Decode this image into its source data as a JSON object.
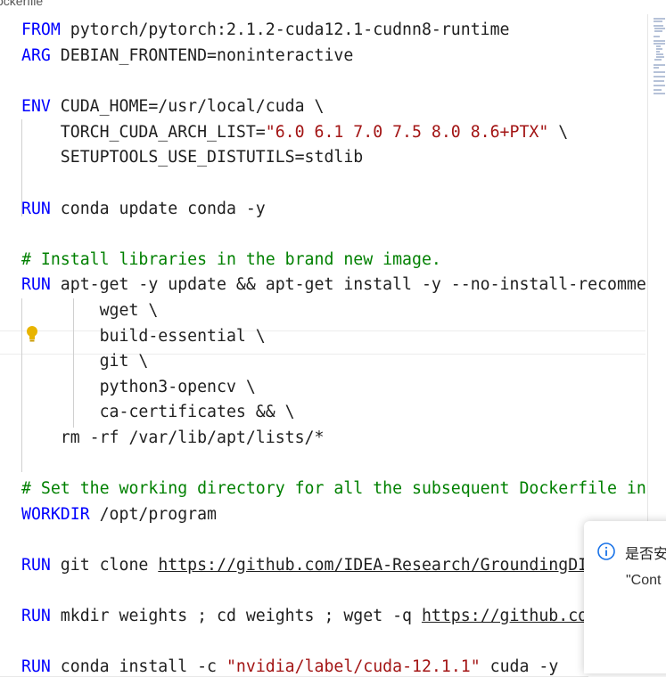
{
  "tab": {
    "title": "ockerfile"
  },
  "editor": {
    "lines": [
      [
        {
          "t": "FROM",
          "c": "kw"
        },
        {
          "t": " pytorch/pytorch:2.1.2-cuda12.1-cudnn8-runtime"
        }
      ],
      [
        {
          "t": "ARG",
          "c": "kw"
        },
        {
          "t": " DEBIAN_FRONTEND=noninteractive"
        }
      ],
      [],
      [
        {
          "t": "ENV",
          "c": "kw"
        },
        {
          "t": " CUDA_HOME=/usr/local/cuda \\"
        }
      ],
      [
        {
          "t": "    TORCH_CUDA_ARCH_LIST="
        },
        {
          "t": "\"6.0 6.1 7.0 7.5 8.0 8.6+PTX\"",
          "c": "str"
        },
        {
          "t": " \\"
        }
      ],
      [
        {
          "t": "    SETUPTOOLS_USE_DISTUTILS=stdlib"
        }
      ],
      [],
      [
        {
          "t": "RUN",
          "c": "kw"
        },
        {
          "t": " conda update conda -y"
        }
      ],
      [],
      [
        {
          "t": "# Install libraries in the brand new image.",
          "c": "cmt"
        }
      ],
      [
        {
          "t": "RUN",
          "c": "kw"
        },
        {
          "t": " apt-get -y update && apt-get install -y --no-install-recommends \\"
        }
      ],
      [
        {
          "t": "        wget \\"
        }
      ],
      [
        {
          "t": "        build-essential \\"
        }
      ],
      [
        {
          "t": "        git \\"
        }
      ],
      [
        {
          "t": "        python3-opencv \\"
        }
      ],
      [
        {
          "t": "        ca-certificates && \\"
        }
      ],
      [
        {
          "t": "    rm -rf /var/lib/apt/lists/*"
        }
      ],
      [],
      [
        {
          "t": "# Set the working directory for all the subsequent Dockerfile instructions.",
          "c": "cmt"
        }
      ],
      [
        {
          "t": "WORKDIR",
          "c": "kw"
        },
        {
          "t": " /opt/program"
        }
      ],
      [],
      [
        {
          "t": "RUN",
          "c": "kw"
        },
        {
          "t": " git clone "
        },
        {
          "t": "https://github.com/IDEA-Research/GroundingDINO.git",
          "c": "url"
        }
      ],
      [],
      [
        {
          "t": "RUN",
          "c": "kw"
        },
        {
          "t": " mkdir weights ; cd weights ; wget -q "
        },
        {
          "t": "https://github.com/IDEA-Research",
          "c": "url"
        }
      ],
      [],
      [
        {
          "t": "RUN",
          "c": "kw"
        },
        {
          "t": " conda install -c "
        },
        {
          "t": "\"nvidia/label/cuda-12.1.1\"",
          "c": "str"
        },
        {
          "t": " cuda -y"
        }
      ]
    ]
  },
  "notification": {
    "title": "是否安装",
    "body": "\"Cont"
  }
}
